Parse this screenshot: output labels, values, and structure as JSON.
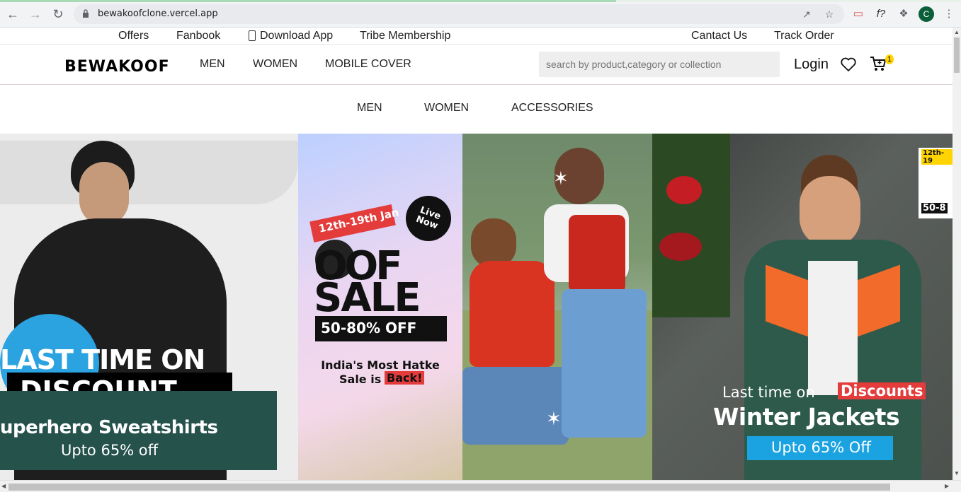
{
  "browser": {
    "url": "bewakoofclone.vercel.app",
    "profile_initial": "C"
  },
  "topbar": {
    "offers": "Offers",
    "fanbook": "Fanbook",
    "download_app": "Download App",
    "tribe": "Tribe Membership",
    "contact": "Cantact Us",
    "track": "Track Order"
  },
  "header": {
    "logo": "BEWAKOOF",
    "nav": [
      "MEN",
      "WOMEN",
      "MOBILE COVER"
    ],
    "search_placeholder": "search by product,category or collection",
    "login": "Login",
    "cart_count": "1"
  },
  "subnav": [
    "MEN",
    "WOMEN",
    "ACCESSORIES"
  ],
  "banners": {
    "b1": {
      "line1": "LAST TIME ON",
      "line2": "DISCOUNT",
      "line3": "uperhero Sweatshirts",
      "line4": "Upto 65% off"
    },
    "b2": {
      "dates": "12th-19th Jan",
      "badge": "Live Now",
      "title1": "OOF",
      "title2": "SALE",
      "discount": "50-80% OFF",
      "tag1": "India's Most Hatke",
      "tag2a": "Sale is",
      "tag2b": "Back!"
    },
    "b4": {
      "line1a": "Last time on",
      "line1b": "Discounts",
      "line2": "Winter Jackets",
      "line3": "Upto 65% Off",
      "corner_dates": "12th-19",
      "corner_off": "50-8"
    }
  },
  "colors": {
    "accent_red": "#e43b3b",
    "teal": "#26524c",
    "blue_tag": "#1aa3e0",
    "cart_badge": "#ffd400"
  }
}
